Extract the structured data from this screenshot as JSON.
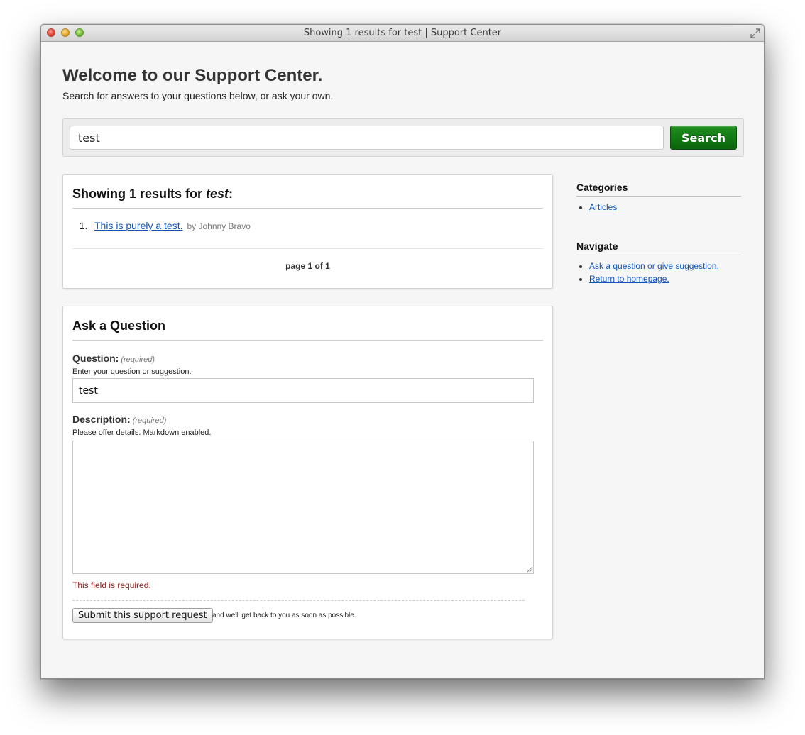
{
  "window": {
    "title": "Showing 1 results for test | Support Center"
  },
  "header": {
    "heading": "Welcome to our Support Center.",
    "subtitle": "Search for answers to your questions below, or ask your own."
  },
  "search": {
    "value": "test",
    "button_label": "Search",
    "button_color": "#0f760f"
  },
  "results": {
    "heading_prefix": "Showing 1 results for ",
    "heading_query": "test",
    "heading_suffix": ":",
    "items": [
      {
        "number": "1.",
        "title": "This is purely a test.",
        "author": "by Johnny Bravo"
      }
    ],
    "pager": "page 1 of 1"
  },
  "ask": {
    "heading": "Ask a Question",
    "question_label": "Question:",
    "question_required": "(required)",
    "question_hint": "Enter your question or suggestion.",
    "question_value": "test",
    "description_label": "Description:",
    "description_required": "(required)",
    "description_hint": "Please offer details. Markdown enabled.",
    "description_value": "",
    "error": "This field is required.",
    "submit_label": "Submit this support request",
    "submit_note": "and we'll get back to you as soon as possible."
  },
  "sidebar": {
    "categories_title": "Categories",
    "categories": [
      "Articles"
    ],
    "navigate_title": "Navigate",
    "navigate": [
      "Ask a question or give suggestion.",
      "Return to homepage."
    ]
  },
  "colors": {
    "link": "#1155bb",
    "error": "#8b1a1a"
  }
}
